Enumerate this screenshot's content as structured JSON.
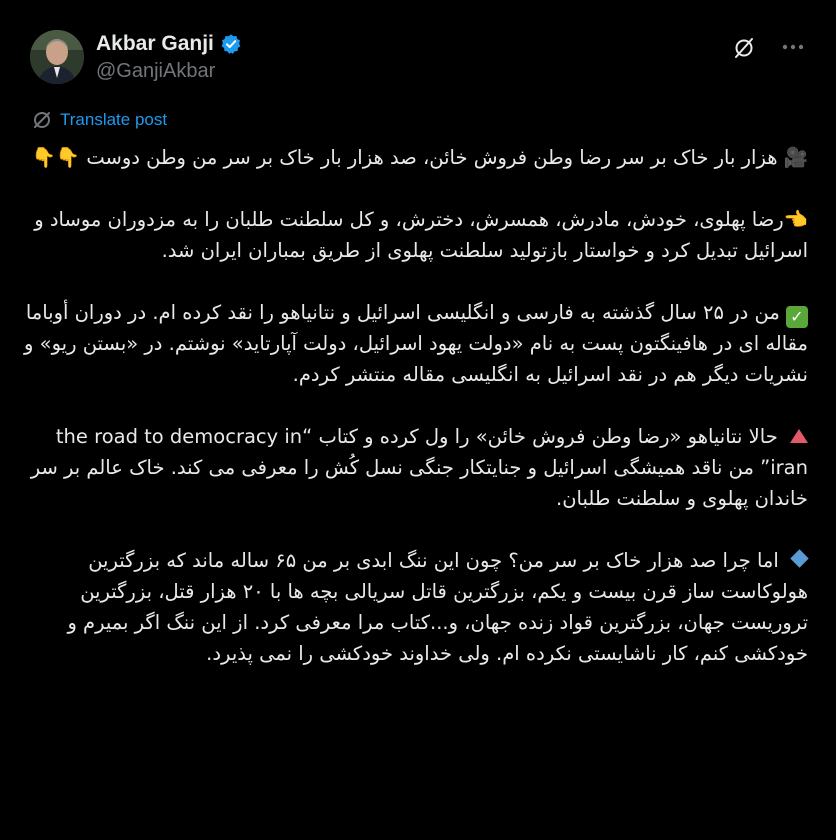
{
  "author": {
    "name": "Akbar Ganji",
    "handle": "@GanjiAkbar",
    "verified": true
  },
  "actions": {
    "grok_icon": "grok-icon",
    "more_icon": "more-icon"
  },
  "translate_label": "Translate post",
  "colors": {
    "background": "#000000",
    "text": "#e7e9ea",
    "muted": "#71767b",
    "link": "#1d9bf0",
    "verified_badge": "#1d9bf0"
  },
  "post": {
    "p1_emoji": "🎥",
    "p1_text": "هزار بار خاک بر سر رضا وطن فروش خائن، صد هزار بار خاک بر سر من وطن دوست",
    "p1_end_emoji": "👇👇",
    "p2_emoji": "👈",
    "p2_text": "رضا پهلوی، خودش، مادرش، همسرش، دخترش، و کل سلطنت طلبان را به مزدوران موساد و اسرائیل تبدیل کرد و خواستار بازتولید سلطنت پهلوی از طریق بمباران ایران شد.",
    "p3_emoji": "✅",
    "p3_text": "من در ۲۵ سال گذشته به فارسی و انگلیسی اسرائیل و نتانیاهو را نقد کرده ام. در دوران أوباما مقاله ای در هافینگتون پست به نام «دولت یهود اسرائیل، دولت آپارتاید» نوشتم. در «بستن ریو» و نشریات دیگر هم در نقد اسرائیل به انگلیسی مقاله منتشر کردم.",
    "p4_emoji": "🔺",
    "p4_text": "حالا نتانیاهو «رضا وطن فروش خائن» را ول کرده و کتاب “the road to democracy in iran” من ناقد همیشگی اسرائیل و جنایتکار جنگی نسل کُش را معرفی می کند. خاک عالم بر سر خاندان پهلوی و سلطنت طلبان.",
    "p5_emoji": "🔹",
    "p5_text": "اما چرا صد هزار خاک بر سر من؟ چون این ننگ ابدی بر من ۶۵ ساله ماند که بزرگترین هولوکاست ساز قرن بیست و یکم، بزرگترین قاتل سریالی بچه ها با ۲۰ هزار قتل، بزرگترین تروریست جهان، بزرگترین قواد زنده جهان، و...کتاب مرا معرفی کرد. از این ننگ اگر بمیرم و خودکشی کنم، کار ناشایستی نکرده ام. ولی خداوند خودکشی را نمی پذیرد."
  }
}
